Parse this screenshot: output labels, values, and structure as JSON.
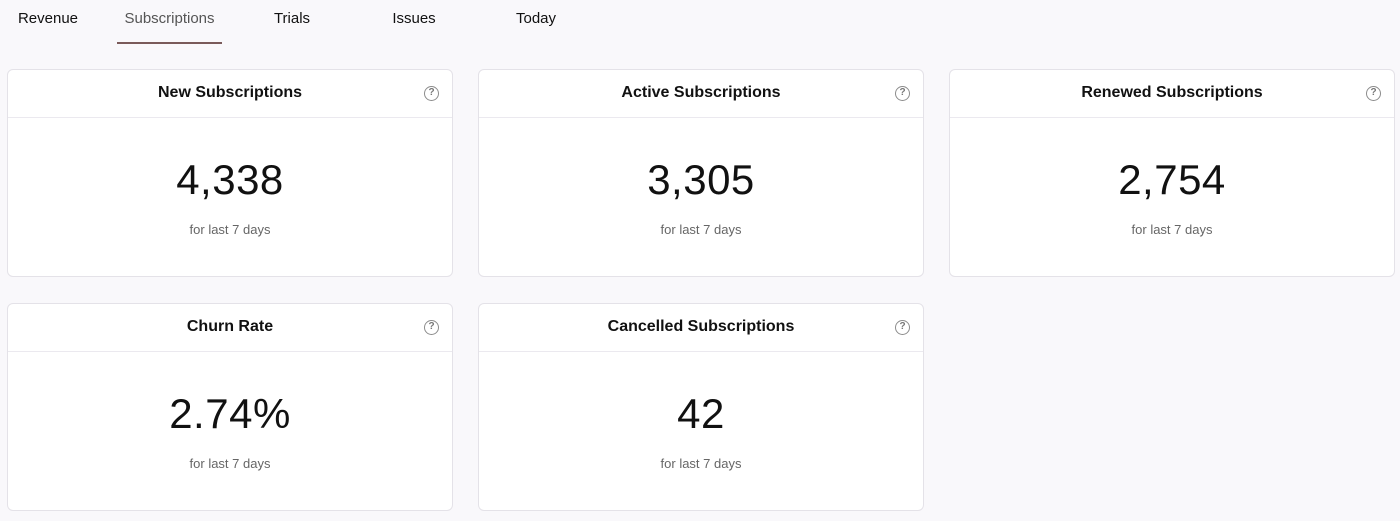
{
  "tabs": [
    {
      "label": "Revenue",
      "active": false
    },
    {
      "label": "Subscriptions",
      "active": true
    },
    {
      "label": "Trials",
      "active": false
    },
    {
      "label": "Issues",
      "active": false
    },
    {
      "label": "Today",
      "active": false
    }
  ],
  "cards": [
    {
      "title": "New Subscriptions",
      "value": "4,338",
      "subtitle": "for last 7 days",
      "help_icon": "question-circle-icon"
    },
    {
      "title": "Active Subscriptions",
      "value": "3,305",
      "subtitle": "for last 7 days",
      "help_icon": "question-circle-icon"
    },
    {
      "title": "Renewed Subscriptions",
      "value": "2,754",
      "subtitle": "for last 7 days",
      "help_icon": "question-circle-icon"
    },
    {
      "title": "Churn Rate",
      "value": "2.74%",
      "subtitle": "for last 7 days",
      "help_icon": "question-circle-icon"
    },
    {
      "title": "Cancelled Subscriptions",
      "value": "42",
      "subtitle": "for last 7 days",
      "help_icon": "question-circle-icon"
    }
  ],
  "colors": {
    "background": "#f9f8fb",
    "active_tab_underline": "#7a5a5a",
    "card_border": "#e4e2e8"
  }
}
